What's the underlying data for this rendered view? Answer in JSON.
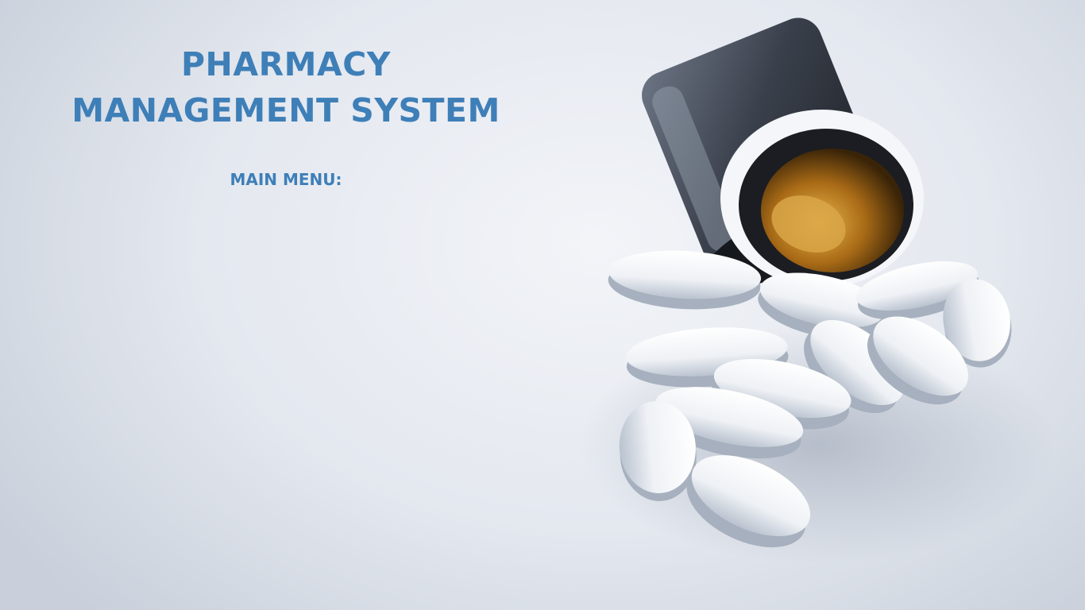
{
  "header": {
    "title_line1": "PHARMACY",
    "title_line2": "MANAGEMENT SYSTEM"
  },
  "menu": {
    "label": "MAIN MENU:"
  },
  "colors": {
    "title_color": "#3e7fb8",
    "background": "#e6eaf0"
  },
  "background_image": {
    "subject": "pill-bottle-with-spilled-white-tablets"
  }
}
